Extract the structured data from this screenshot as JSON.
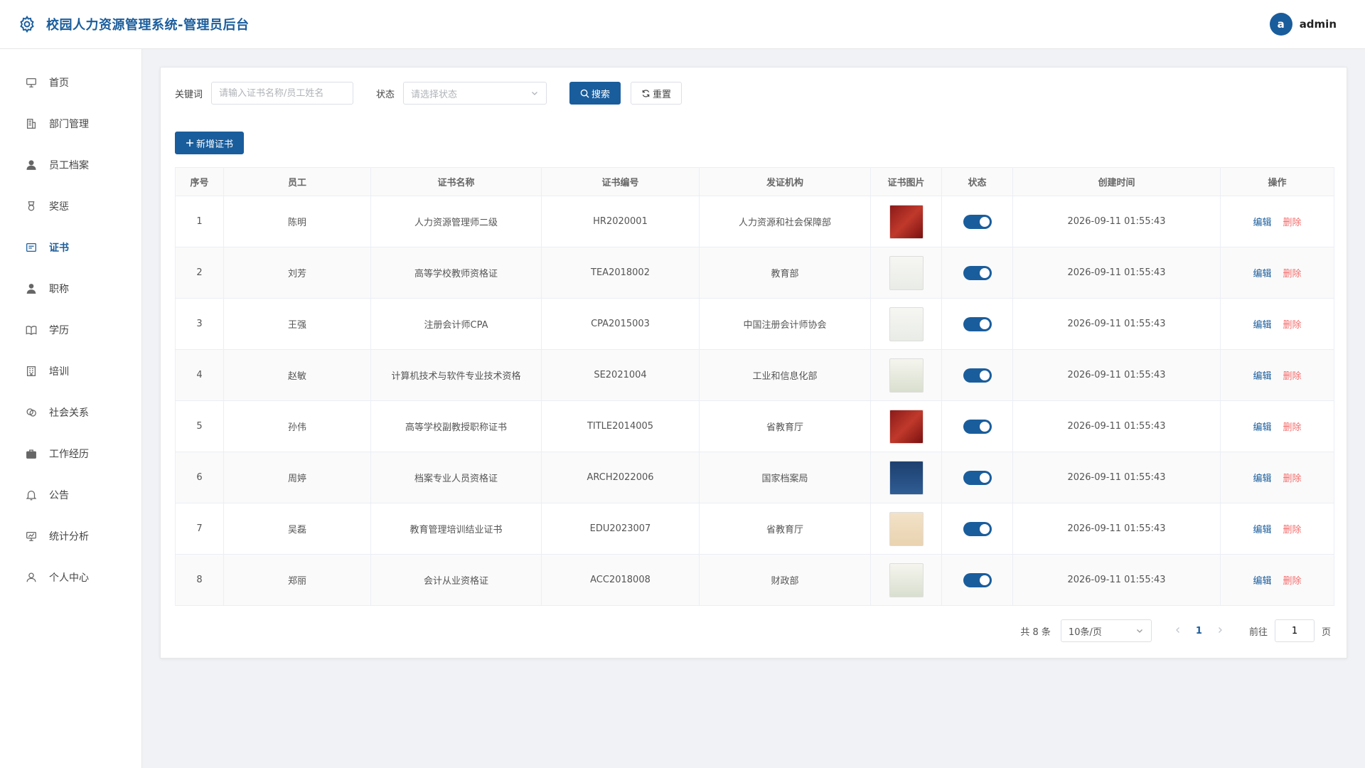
{
  "header": {
    "title": "校园人力资源管理系统-管理员后台",
    "avatar_letter": "a",
    "username": "admin"
  },
  "sidebar": {
    "items": [
      {
        "label": "首页",
        "icon": "monitor-icon"
      },
      {
        "label": "部门管理",
        "icon": "building-icon"
      },
      {
        "label": "员工档案",
        "icon": "user-icon"
      },
      {
        "label": "奖惩",
        "icon": "medal-icon"
      },
      {
        "label": "证书",
        "icon": "certificate-icon",
        "active": true
      },
      {
        "label": "职称",
        "icon": "title-icon"
      },
      {
        "label": "学历",
        "icon": "book-icon"
      },
      {
        "label": "培训",
        "icon": "office-icon"
      },
      {
        "label": "社会关系",
        "icon": "relation-icon"
      },
      {
        "label": "工作经历",
        "icon": "briefcase-icon"
      },
      {
        "label": "公告",
        "icon": "bell-icon"
      },
      {
        "label": "统计分析",
        "icon": "chart-icon"
      },
      {
        "label": "个人中心",
        "icon": "profile-icon"
      }
    ]
  },
  "search": {
    "keyword_label": "关键词",
    "keyword_placeholder": "请输入证书名称/员工姓名",
    "status_label": "状态",
    "status_placeholder": "请选择状态",
    "search_button": "搜索",
    "reset_button": "重置"
  },
  "add_button": "新增证书",
  "table": {
    "headers": [
      "序号",
      "员工",
      "证书名称",
      "证书编号",
      "发证机构",
      "证书图片",
      "状态",
      "创建时间",
      "操作"
    ],
    "edit_label": "编辑",
    "delete_label": "删除",
    "rows": [
      {
        "no": "1",
        "employee": "陈明",
        "name": "人力资源管理师二级",
        "code": "HR2020001",
        "issuer": "人力资源和社会保障部",
        "image": "red",
        "status": true,
        "created": "2026-09-11 01:55:43"
      },
      {
        "no": "2",
        "employee": "刘芳",
        "name": "高等学校教师资格证",
        "code": "TEA2018002",
        "issuer": "教育部",
        "image": "white",
        "status": true,
        "created": "2026-09-11 01:55:43"
      },
      {
        "no": "3",
        "employee": "王强",
        "name": "注册会计师CPA",
        "code": "CPA2015003",
        "issuer": "中国注册会计师协会",
        "image": "white",
        "status": true,
        "created": "2026-09-11 01:55:43"
      },
      {
        "no": "4",
        "employee": "赵敏",
        "name": "计算机技术与软件专业技术资格",
        "code": "SE2021004",
        "issuer": "工业和信息化部",
        "image": "frame",
        "status": true,
        "created": "2026-09-11 01:55:43"
      },
      {
        "no": "5",
        "employee": "孙伟",
        "name": "高等学校副教授职称证书",
        "code": "TITLE2014005",
        "issuer": "省教育厅",
        "image": "red",
        "status": true,
        "created": "2026-09-11 01:55:43"
      },
      {
        "no": "6",
        "employee": "周婷",
        "name": "档案专业人员资格证",
        "code": "ARCH2022006",
        "issuer": "国家档案局",
        "image": "blue",
        "status": true,
        "created": "2026-09-11 01:55:43"
      },
      {
        "no": "7",
        "employee": "吴磊",
        "name": "教育管理培训结业证书",
        "code": "EDU2023007",
        "issuer": "省教育厅",
        "image": "cream",
        "status": true,
        "created": "2026-09-11 01:55:43"
      },
      {
        "no": "8",
        "employee": "郑丽",
        "name": "会计从业资格证",
        "code": "ACC2018008",
        "issuer": "财政部",
        "image": "frame",
        "status": true,
        "created": "2026-09-11 01:55:43"
      }
    ]
  },
  "pagination": {
    "total_text": "共 8 条",
    "page_size": "10条/页",
    "current_page": "1",
    "goto_label": "前往",
    "goto_value": "1",
    "page_suffix": "页"
  },
  "colors": {
    "primary": "#1a5d9c",
    "danger": "#f56c6c"
  }
}
